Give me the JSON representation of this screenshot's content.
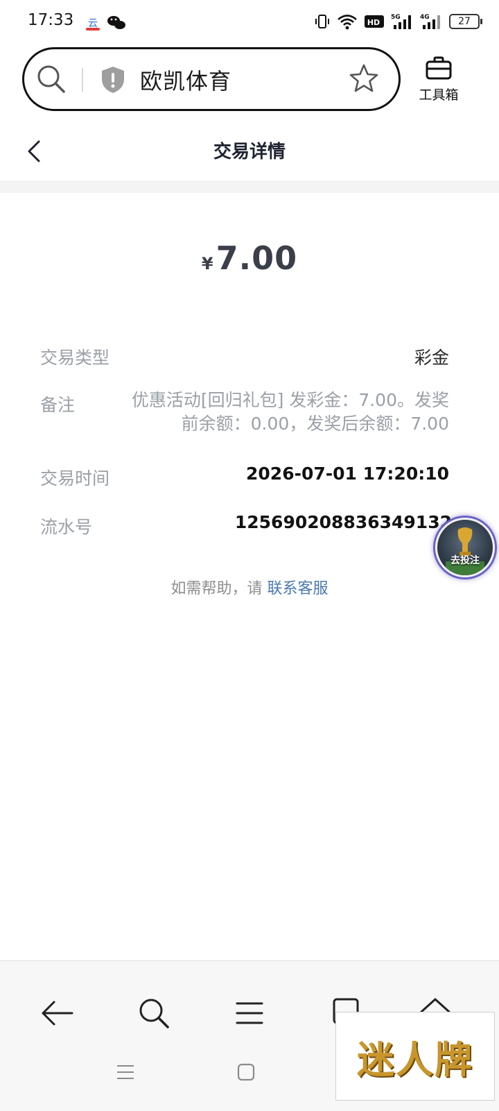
{
  "status_bar": {
    "time": "17:33",
    "battery": "27",
    "icons": [
      "app-icon",
      "wechat-icon",
      "vibrate-icon",
      "wifi-icon",
      "hd-icon",
      "5g-signal-icon",
      "4g-signal-icon",
      "battery-icon"
    ]
  },
  "browser": {
    "address_text": "欧凯体育",
    "toolbox_label": "工具箱"
  },
  "page": {
    "title": "交易详情",
    "amount_currency": "¥",
    "amount": "7.00"
  },
  "details": {
    "type_label": "交易类型",
    "type_value": "彩金",
    "remark_label": "备注",
    "remark_value": "优惠活动[回归礼包] 发彩金：7.00。发奖前余额：0.00，发奖后余额：7.00",
    "time_label": "交易时间",
    "time_value": "2026-07-01 17:20:10",
    "serial_label": "流水号",
    "serial_value": "125690208836349132"
  },
  "help": {
    "prefix": "如需帮助，请",
    "link": "联系客服"
  },
  "floating": {
    "label": "去投注"
  },
  "watermark": {
    "text": "迷人牌"
  },
  "colors": {
    "link": "#4a78b0",
    "muted": "#9aa0a6",
    "amount": "#3b3f4a"
  }
}
